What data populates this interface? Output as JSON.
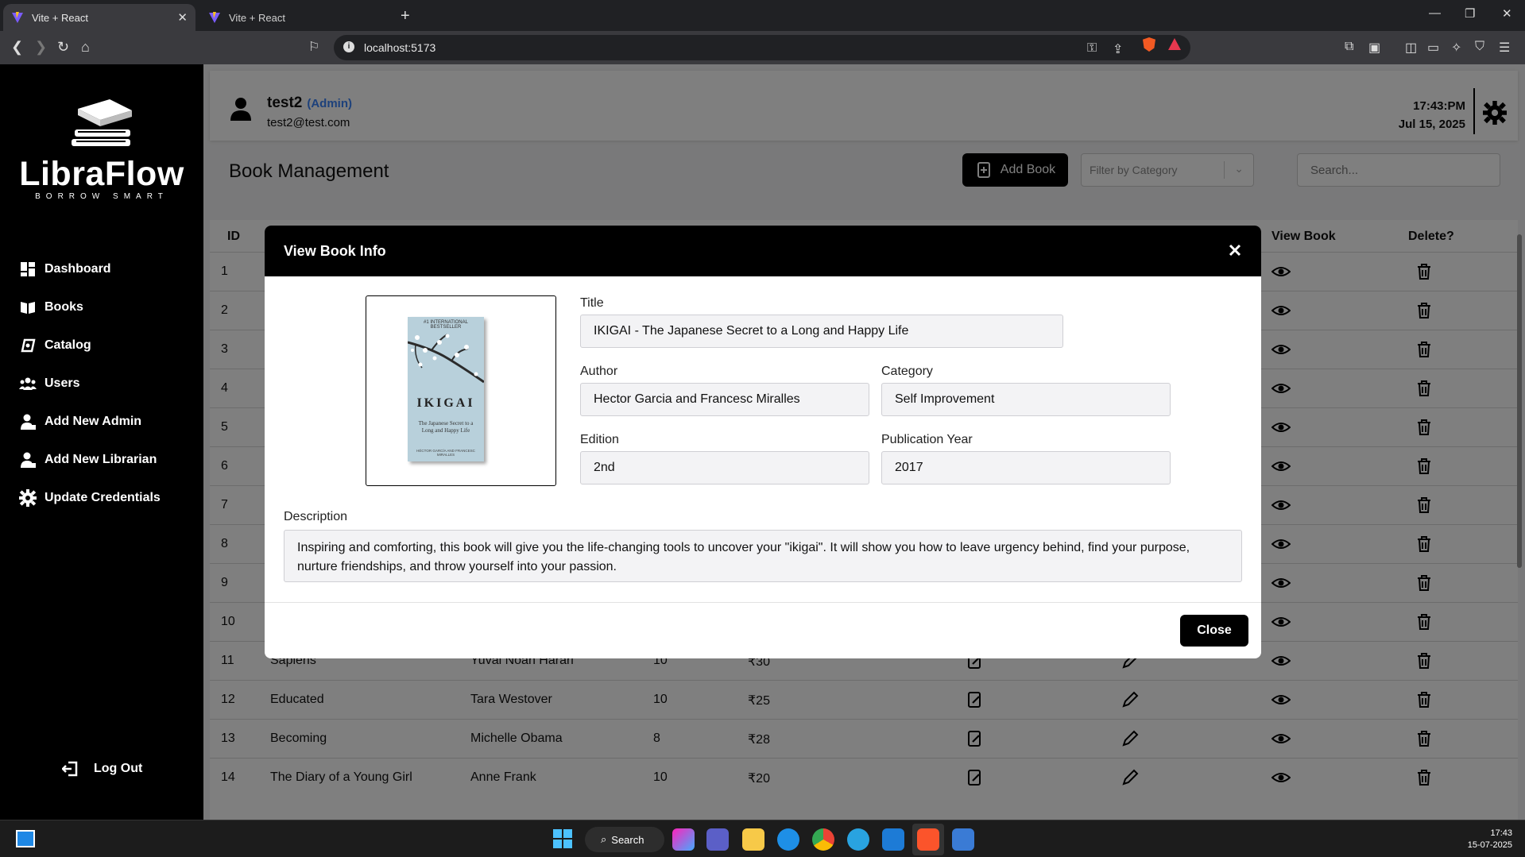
{
  "browser": {
    "tabs": [
      {
        "title": "Vite + React",
        "active": true
      },
      {
        "title": "Vite + React",
        "active": false
      }
    ],
    "url": "localhost:5173"
  },
  "sidebar": {
    "brand": "LibraFlow",
    "tagline": "BORROW SMART",
    "items": [
      {
        "label": "Dashboard",
        "icon": "dashboard-icon"
      },
      {
        "label": "Books",
        "icon": "books-icon"
      },
      {
        "label": "Catalog",
        "icon": "catalog-icon"
      },
      {
        "label": "Users",
        "icon": "users-icon"
      },
      {
        "label": "Add New Admin",
        "icon": "add-admin-icon"
      },
      {
        "label": "Add New Librarian",
        "icon": "add-librarian-icon"
      },
      {
        "label": "Update Credentials",
        "icon": "gear-icon"
      }
    ],
    "logout": "Log Out"
  },
  "header": {
    "username": "test2",
    "role": "(Admin)",
    "email": "test2@test.com",
    "time": "17:43:PM",
    "date": "Jul 15, 2025"
  },
  "page": {
    "title": "Book Management",
    "add_book": "Add Book",
    "filter_placeholder": "Filter by Category",
    "search_placeholder": "Search..."
  },
  "table": {
    "headers": {
      "id": "ID",
      "view": "View Book",
      "delete": "Delete?"
    },
    "rows": [
      {
        "id": "1",
        "title": "",
        "author": "",
        "qty": "",
        "price": ""
      },
      {
        "id": "2",
        "title": "",
        "author": "",
        "qty": "",
        "price": ""
      },
      {
        "id": "3",
        "title": "",
        "author": "",
        "qty": "",
        "price": ""
      },
      {
        "id": "4",
        "title": "",
        "author": "",
        "qty": "",
        "price": ""
      },
      {
        "id": "5",
        "title": "",
        "author": "",
        "qty": "",
        "price": ""
      },
      {
        "id": "6",
        "title": "",
        "author": "",
        "qty": "",
        "price": ""
      },
      {
        "id": "7",
        "title": "",
        "author": "",
        "qty": "",
        "price": ""
      },
      {
        "id": "8",
        "title": "",
        "author": "",
        "qty": "",
        "price": ""
      },
      {
        "id": "9",
        "title": "",
        "author": "",
        "qty": "",
        "price": ""
      },
      {
        "id": "10",
        "title": "",
        "author": "",
        "qty": "",
        "price": ""
      },
      {
        "id": "11",
        "title": "Sapiens",
        "author": "Yuval Noah Harari",
        "qty": "10",
        "price": "₹30"
      },
      {
        "id": "12",
        "title": "Educated",
        "author": "Tara Westover",
        "qty": "10",
        "price": "₹25"
      },
      {
        "id": "13",
        "title": "Becoming",
        "author": "Michelle Obama",
        "qty": "8",
        "price": "₹28"
      },
      {
        "id": "14",
        "title": "The Diary of a Young Girl",
        "author": "Anne Frank",
        "qty": "10",
        "price": "₹20"
      }
    ]
  },
  "modal": {
    "title": "View Book Info",
    "cover": {
      "top_text": "#1 INTERNATIONAL BESTSELLER",
      "title": "IKIGAI",
      "subtitle": "The Japanese Secret to a Long and Happy Life",
      "authors": "HÉCTOR GARCÍA AND FRANCESC MIRALLES"
    },
    "labels": {
      "title": "Title",
      "author": "Author",
      "category": "Category",
      "edition": "Edition",
      "year": "Publication Year",
      "description": "Description"
    },
    "values": {
      "title": "IKIGAI - The Japanese Secret to a Long and Happy Life",
      "author": "Hector Garcia and Francesc Miralles",
      "category": "Self Improvement",
      "edition": "2nd",
      "year": "2017",
      "description": "Inspiring and comforting, this book will give you the life-changing tools to uncover your \"ikigai\". It will show you how to leave urgency behind, find your purpose, nurture friendships, and throw yourself into your passion."
    },
    "close": "Close"
  },
  "taskbar": {
    "search": "Search",
    "time": "17:43",
    "date": "15-07-2025"
  },
  "colors": {
    "accent": "#000000",
    "role": "#3b82f6",
    "overlay": "rgba(0,0,0,0.5)"
  }
}
